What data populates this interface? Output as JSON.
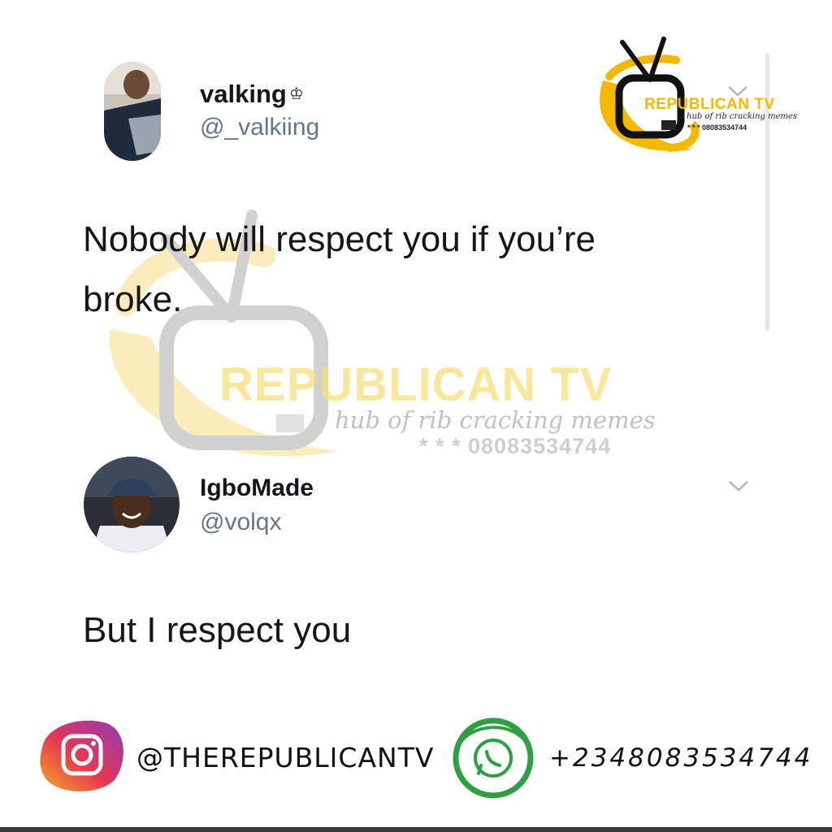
{
  "tweets": [
    {
      "name": "valking",
      "badge": "♔",
      "handle": "@_valkiing",
      "text": "Nobody will respect you if you’re broke."
    },
    {
      "name": "IgboMade",
      "handle": "@volqx",
      "text": "But I respect you"
    }
  ],
  "watermark": {
    "title": "REPUBLICAN TV",
    "subtitle": "hub of rib cracking memes",
    "phone": "* * * 08083534744"
  },
  "logo": {
    "title": "REPUBLICAN TV",
    "subtitle": "hub of rib cracking memes",
    "phone": "* * * 08083534744"
  },
  "footer": {
    "instagram_handle": "@THEREPUBLICANTV",
    "whatsapp_number": "+2348083534744"
  },
  "icons": {
    "chevron": "chevron-down-icon",
    "instagram": "instagram-icon",
    "whatsapp": "whatsapp-icon"
  },
  "colors": {
    "brand_yellow": "#f5b800",
    "text_primary": "#14171a",
    "text_secondary": "#657786",
    "whatsapp_green": "#2ea043"
  }
}
